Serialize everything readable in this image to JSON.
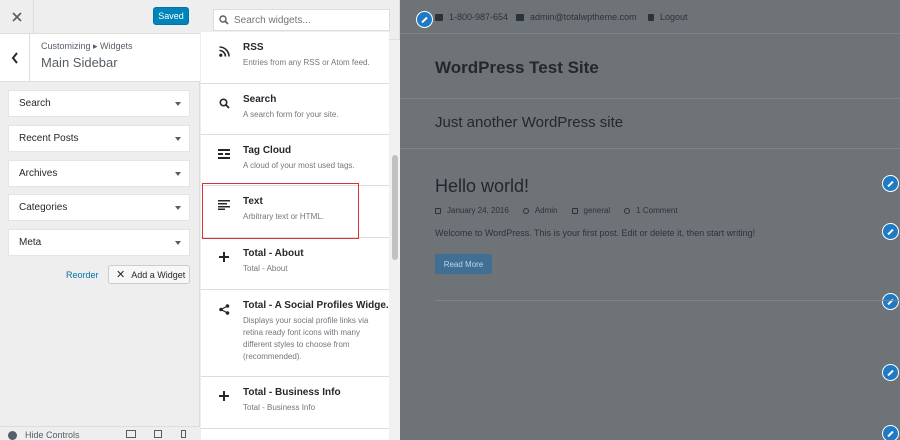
{
  "customizer": {
    "saved_label": "Saved",
    "breadcrumb": "Customizing ▸ Widgets",
    "panel_title": "Main Sidebar",
    "sections": [
      {
        "label": "Search"
      },
      {
        "label": "Recent Posts"
      },
      {
        "label": "Archives"
      },
      {
        "label": "Categories"
      },
      {
        "label": "Meta"
      }
    ],
    "reorder_label": "Reorder",
    "add_widget_label": "Add a Widget",
    "hide_controls_label": "Hide Controls"
  },
  "widgets_panel": {
    "search_placeholder": "Search widgets...",
    "items": [
      {
        "title": "RSS",
        "description": "Entries from any RSS or Atom feed.",
        "icon": "rss-icon"
      },
      {
        "title": "Search",
        "description": "A search form for your site.",
        "icon": "search-icon"
      },
      {
        "title": "Tag Cloud",
        "description": "A cloud of your most used tags.",
        "icon": "tag-cloud-icon"
      },
      {
        "title": "Text",
        "description": "Arbitrary text or HTML.",
        "icon": "text-icon"
      },
      {
        "title": "Total - About",
        "description": "Total - About",
        "icon": "plus-icon"
      },
      {
        "title": "Total - A Social Profiles Widge...",
        "description": "Displays your social profile links via retina ready font icons with many different styles to choose from (recommended).",
        "icon": "share-icon"
      },
      {
        "title": "Total - Business Info",
        "description": "Total - Business Info",
        "icon": "plus-icon"
      }
    ]
  },
  "preview": {
    "topbar": {
      "phone": "1-800-987-654",
      "email": "admin@totalwptheme.com",
      "logout": "Logout"
    },
    "site_title": "WordPress Test Site",
    "tagline": "Just another WordPress site",
    "post": {
      "title": "Hello world!",
      "date": "January 24, 2016",
      "author": "Admin",
      "category": "general",
      "comments": "1 Comment",
      "excerpt": "Welcome to WordPress. This is your first post. Edit or delete it, then start writing!",
      "read_more": "Read More"
    }
  },
  "colors": {
    "accent": "#0085ba",
    "highlight": "#dc3232",
    "overlay": "#6e7378",
    "edit_shortcut": "#1e7ac4"
  }
}
